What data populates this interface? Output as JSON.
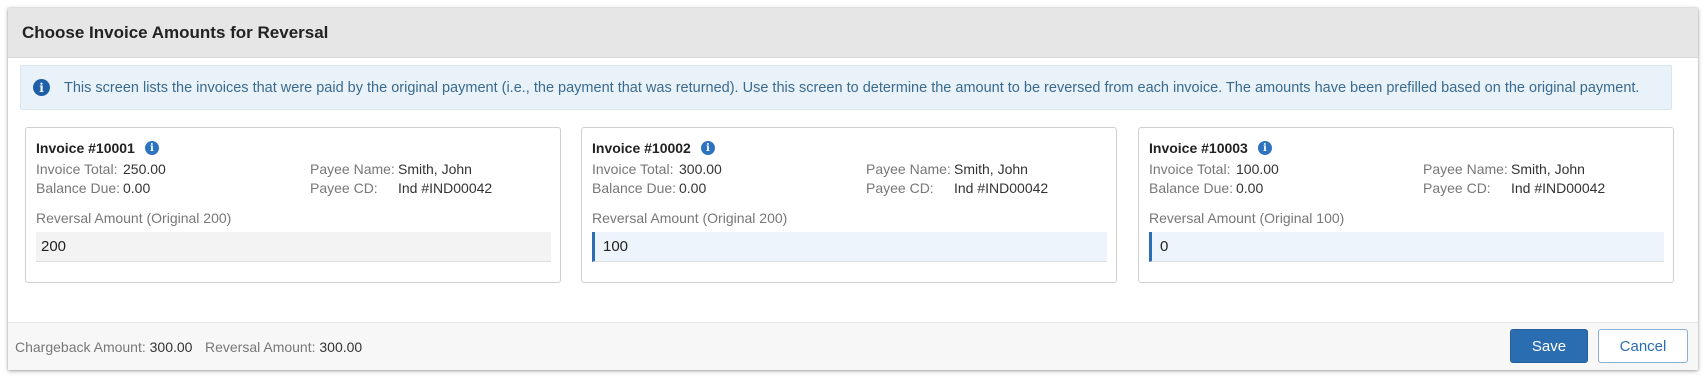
{
  "dialog": {
    "title": "Choose Invoice Amounts for Reversal",
    "info_text": "This screen lists the invoices that were paid by the original payment (i.e., the payment that was returned). Use this screen to determine the amount to be reversed from each invoice. The amounts have been prefilled based on the original payment."
  },
  "labels": {
    "invoice_total": "Invoice Total:",
    "balance_due": "Balance Due:",
    "payee_name": "Payee Name:",
    "payee_cd": "Payee CD:"
  },
  "invoices": [
    {
      "title": "Invoice #10001",
      "invoice_total": "250.00",
      "balance_due": "0.00",
      "payee_name": "Smith, John",
      "payee_cd": "Ind #IND00042",
      "reversal_label": "Reversal Amount (Original 200)",
      "reversal_value": "200"
    },
    {
      "title": "Invoice #10002",
      "invoice_total": "300.00",
      "balance_due": "0.00",
      "payee_name": "Smith, John",
      "payee_cd": "Ind #IND00042",
      "reversal_label": "Reversal Amount (Original 200)",
      "reversal_value": "100"
    },
    {
      "title": "Invoice #10003",
      "invoice_total": "100.00",
      "balance_due": "0.00",
      "payee_name": "Smith, John",
      "payee_cd": "Ind #IND00042",
      "reversal_label": "Reversal Amount (Original 100)",
      "reversal_value": "0"
    }
  ],
  "footer": {
    "chargeback_label": "Chargeback Amount:",
    "chargeback_value": "300.00",
    "reversal_label": "Reversal Amount:",
    "reversal_value": "300.00",
    "save_label": "Save",
    "cancel_label": "Cancel"
  },
  "icons": {
    "info": "info-icon"
  },
  "colors": {
    "primary": "#2a6db0",
    "info_bg": "#e8f2f8",
    "info_text": "#3b6a8f"
  }
}
